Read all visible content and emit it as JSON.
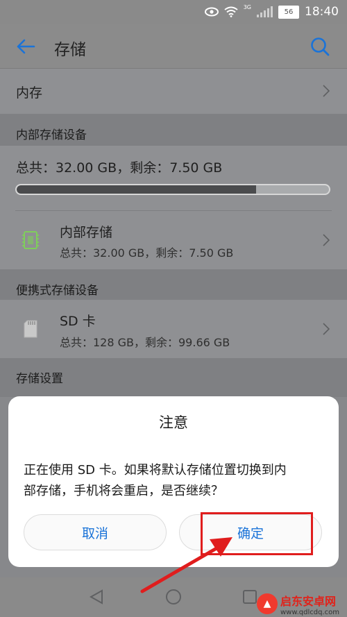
{
  "status_bar": {
    "network_label": "3G",
    "battery": "56",
    "time": "18:40"
  },
  "app_bar": {
    "title": "存储"
  },
  "memory_row": {
    "label": "内存"
  },
  "internal_section": {
    "header": "内部存储设备",
    "summary": "总共：32.00 GB，剩余：7.50 GB",
    "usage_fraction": 0.766,
    "item": {
      "title": "内部存储",
      "subtitle": "总共：32.00 GB，剩余：7.50 GB"
    }
  },
  "portable_section": {
    "header": "便携式存储设备",
    "item": {
      "title": "SD 卡",
      "subtitle": "总共：128 GB，剩余：99.66 GB"
    }
  },
  "settings_section": {
    "header": "存储设置"
  },
  "dialog": {
    "title": "注意",
    "message_line1": "正在使用 SD 卡。如果将默认存储位置切换到内",
    "message_line2": "部存储，手机将会重启，是否继续？",
    "cancel_label": "取消",
    "ok_label": "确定"
  },
  "watermark": {
    "name": "启东安卓网",
    "url": "www.qdlcdq.com"
  },
  "colors": {
    "accent": "#1a73d8",
    "highlight": "#e01d1d",
    "progress_fill": "#4a4b4d"
  }
}
